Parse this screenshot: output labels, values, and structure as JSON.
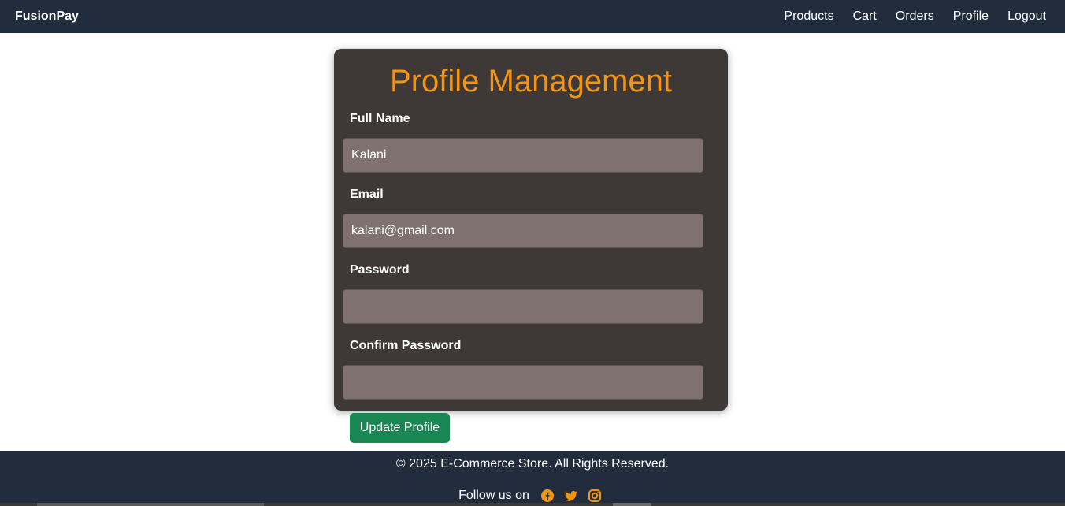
{
  "navbar": {
    "brand": "FusionPay",
    "links": [
      {
        "label": "Products"
      },
      {
        "label": "Cart"
      },
      {
        "label": "Orders"
      },
      {
        "label": "Profile"
      },
      {
        "label": "Logout"
      }
    ]
  },
  "form": {
    "title": "Profile Management",
    "fields": [
      {
        "label": "Full Name",
        "value": "Kalani",
        "placeholder": ""
      },
      {
        "label": "Email",
        "value": "kalani@gmail.com",
        "placeholder": ""
      },
      {
        "label": "Password",
        "value": "",
        "placeholder": ""
      },
      {
        "label": "Confirm Password",
        "value": "",
        "placeholder": ""
      }
    ],
    "submit_label": "Update Profile"
  },
  "footer": {
    "copyright": "© 2025 E-Commerce Store. All Rights Reserved.",
    "follow_text": "Follow us on",
    "social_icons": [
      "facebook-icon",
      "twitter-icon",
      "instagram-icon"
    ]
  },
  "colors": {
    "navbar_bg": "#212d3d",
    "card_bg": "#3e3937",
    "title_accent": "#f39512",
    "input_bg": "#7f7170",
    "button_bg": "#198754",
    "icon_accent": "#f39512"
  }
}
